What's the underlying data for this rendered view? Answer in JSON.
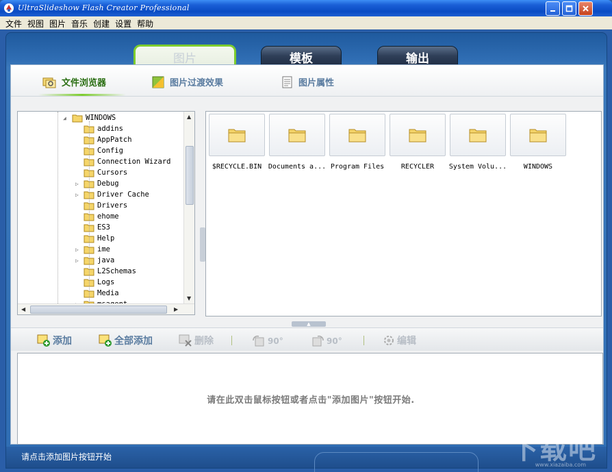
{
  "window": {
    "title": "UltraSlideshow Flash Creator Professional"
  },
  "menu": [
    "文件",
    "视图",
    "图片",
    "音乐",
    "创建",
    "设置",
    "帮助"
  ],
  "main_tabs": [
    {
      "label": "图片",
      "active": true
    },
    {
      "label": "模板",
      "active": false
    },
    {
      "label": "输出",
      "active": false
    }
  ],
  "sub_tabs": [
    {
      "label": "文件浏览器",
      "active": true,
      "icon": "file-browser-icon"
    },
    {
      "label": "图片过渡效果",
      "active": false,
      "icon": "transition-icon"
    },
    {
      "label": "图片属性",
      "active": false,
      "icon": "properties-icon"
    }
  ],
  "tree": {
    "root": "WINDOWS",
    "children": [
      {
        "label": "addins",
        "expandable": false
      },
      {
        "label": "AppPatch",
        "expandable": false
      },
      {
        "label": "Config",
        "expandable": false
      },
      {
        "label": "Connection Wizard",
        "expandable": false
      },
      {
        "label": "Cursors",
        "expandable": false
      },
      {
        "label": "Debug",
        "expandable": true
      },
      {
        "label": "Driver Cache",
        "expandable": true
      },
      {
        "label": "Drivers",
        "expandable": false
      },
      {
        "label": "ehome",
        "expandable": false
      },
      {
        "label": "ES3",
        "expandable": false
      },
      {
        "label": "Help",
        "expandable": false
      },
      {
        "label": "ime",
        "expandable": true
      },
      {
        "label": "java",
        "expandable": true
      },
      {
        "label": "L2Schemas",
        "expandable": false
      },
      {
        "label": "Logs",
        "expandable": false
      },
      {
        "label": "Media",
        "expandable": false
      },
      {
        "label": "msagent",
        "expandable": true
      }
    ]
  },
  "files": [
    {
      "label": "$RECYCLE.BIN"
    },
    {
      "label": "Documents a..."
    },
    {
      "label": "Program Files"
    },
    {
      "label": "RECYCLER"
    },
    {
      "label": "System Volu..."
    },
    {
      "label": "WINDOWS"
    }
  ],
  "actions": {
    "add": "添加",
    "add_all": "全部添加",
    "delete": "删除",
    "rotate_left": "90°",
    "rotate_right": "90°",
    "edit": "编辑"
  },
  "dropzone_hint": "请在此双击鼠标按钮或者点击\"添加图片\"按钮开始.",
  "status_text": "请点击添加图片按钮开始",
  "watermark": "下载吧",
  "watermark_url": "www.xiazaiba.com",
  "colors": {
    "title_bar": "#0a4cc4",
    "frame": "#2f6db3",
    "active_tab_border": "#7dcc2e",
    "action_text": "#5a7ca0"
  }
}
